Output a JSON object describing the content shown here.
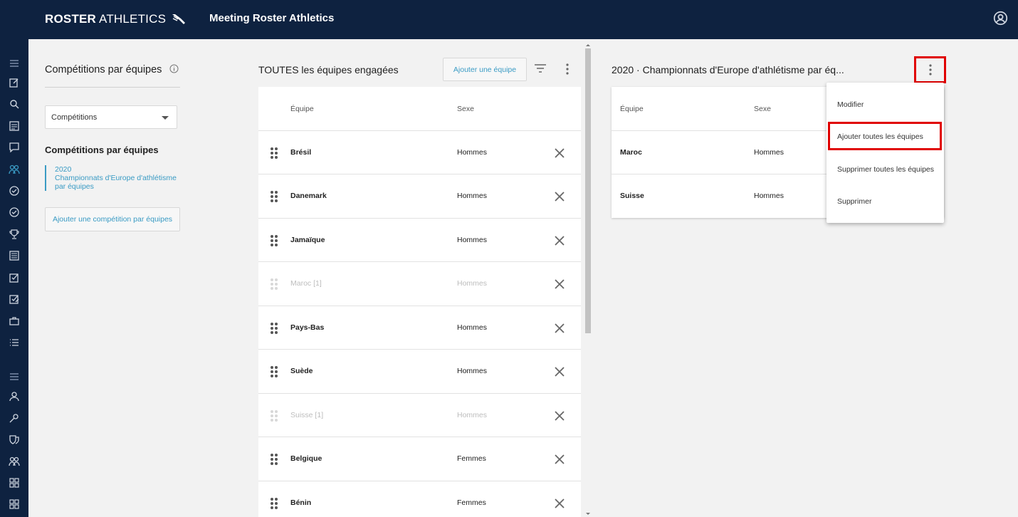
{
  "header": {
    "logo_bold": "ROSTER",
    "logo_light": "ATHLETICS",
    "title": "Meeting Roster Athletics"
  },
  "sidebar": {
    "icons": [
      "menu-icon",
      "edit-icon",
      "search-icon",
      "list-icon",
      "chat-icon",
      "teams-icon",
      "check-circle-icon",
      "check-circle-icon",
      "trophy-icon",
      "document-icon",
      "checkbox-icon",
      "checkbox-edit-icon",
      "briefcase-icon",
      "bullet-list-icon",
      "menu-icon",
      "person-icon",
      "runner-icon",
      "shield-icon",
      "group-icon",
      "grid-icon",
      "grid-icon"
    ]
  },
  "competitions_panel": {
    "title": "Compétitions par équipes",
    "select_value": "Compétitions",
    "subtitle": "Compétitions par équipes",
    "item_year": "2020",
    "item_name": "Championnats d'Europe d'athlétisme par équipes",
    "add_button": "Ajouter une compétition par équipes"
  },
  "teams_panel": {
    "title": "TOUTES les équipes engagées",
    "add_button": "Ajouter une équipe",
    "col_team": "Équipe",
    "col_sex": "Sexe",
    "rows": [
      {
        "name": "Brésil",
        "sex": "Hommes"
      },
      {
        "name": "Danemark",
        "sex": "Hommes"
      },
      {
        "name": "Jamaïque",
        "sex": "Hommes"
      },
      {
        "name": "Maroc [1]",
        "sex": "Hommes"
      },
      {
        "name": "Pays-Bas",
        "sex": "Hommes"
      },
      {
        "name": "Suède",
        "sex": "Hommes"
      },
      {
        "name": "Suisse [1]",
        "sex": "Hommes"
      },
      {
        "name": "Belgique",
        "sex": "Femmes"
      },
      {
        "name": "Bénin",
        "sex": "Femmes"
      }
    ]
  },
  "competition_panel": {
    "title": "2020 · Championnats d'Europe d'athlétisme par éq...",
    "col_team": "Équipe",
    "col_sex": "Sexe",
    "rows": [
      {
        "name": "Maroc",
        "sex": "Hommes"
      },
      {
        "name": "Suisse",
        "sex": "Hommes"
      }
    ]
  },
  "context_menu": {
    "items": [
      "Modifier",
      "Ajouter toutes les équipes",
      "Supprimer toutes les équipes",
      "Supprimer"
    ]
  },
  "colors": {
    "navy": "#0e2240",
    "accent": "#3a9bc4",
    "highlight": "#e00000"
  }
}
